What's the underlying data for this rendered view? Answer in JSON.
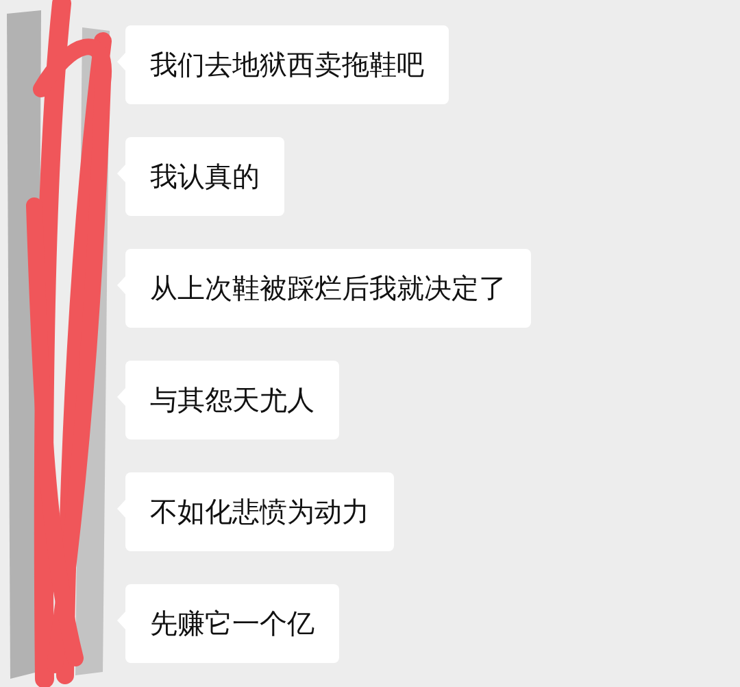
{
  "messages": [
    {
      "text": "我们去地狱西卖拖鞋吧"
    },
    {
      "text": "我认真的"
    },
    {
      "text": "从上次鞋被踩烂后我就决定了"
    },
    {
      "text": "与其怨天尤人"
    },
    {
      "text": "不如化悲愤为动力"
    },
    {
      "text": "先赚它一个亿"
    }
  ]
}
